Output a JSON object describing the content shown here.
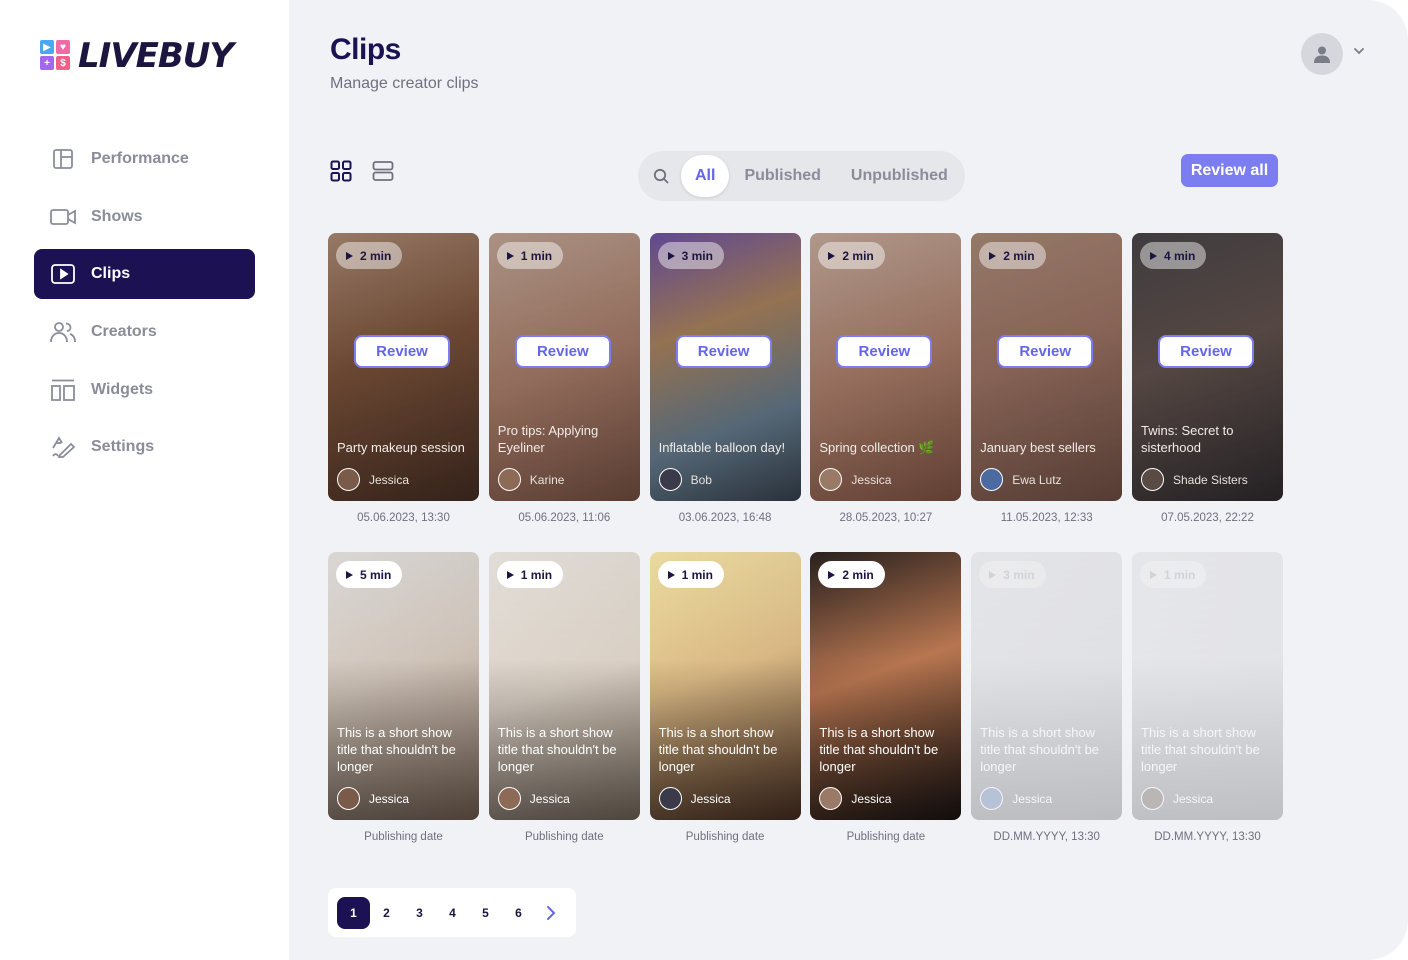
{
  "app": {
    "name": "LIVEBUY"
  },
  "sidebar": {
    "items": [
      {
        "label": "Performance",
        "icon": "layout-icon"
      },
      {
        "label": "Shows",
        "icon": "video-camera-icon"
      },
      {
        "label": "Clips",
        "icon": "play-square-icon",
        "active": true
      },
      {
        "label": "Creators",
        "icon": "users-icon"
      },
      {
        "label": "Widgets",
        "icon": "widgets-icon"
      },
      {
        "label": "Settings",
        "icon": "pen-settings-icon"
      }
    ]
  },
  "header": {
    "title": "Clips",
    "subtitle": "Manage creator clips"
  },
  "filters": {
    "tabs": [
      "All",
      "Published",
      "Unpublished"
    ],
    "active": "All"
  },
  "toolbar": {
    "review_all": "Review all"
  },
  "review_label": "Review",
  "clips": [
    {
      "duration": "2 min",
      "title": "Party makeup session",
      "author": "Jessica",
      "date": "05.06.2023, 13:30",
      "state": "pending"
    },
    {
      "duration": "1 min",
      "title": "Pro tips: Applying Eyeliner",
      "author": "Karine",
      "date": "05.06.2023, 11:06",
      "state": "pending"
    },
    {
      "duration": "3 min",
      "title": "Inflatable balloon day!",
      "author": "Bob",
      "date": "03.06.2023, 16:48",
      "state": "pending"
    },
    {
      "duration": "2 min",
      "title": "Spring collection 🌿",
      "author": "Jessica",
      "date": "28.05.2023, 10:27",
      "state": "pending"
    },
    {
      "duration": "2 min",
      "title": "January best sellers",
      "author": "Ewa Lutz",
      "date": "11.05.2023, 12:33",
      "state": "pending"
    },
    {
      "duration": "4 min",
      "title": "Twins: Secret to sisterhood",
      "author": "Shade Sisters",
      "date": "07.05.2023, 22:22",
      "state": "pending"
    },
    {
      "duration": "5 min",
      "title": "This is a short show title that shouldn't be longer",
      "author": "Jessica",
      "date": "Publishing date",
      "state": "published"
    },
    {
      "duration": "1 min",
      "title": "This is a short show title that shouldn't be longer",
      "author": "Jessica",
      "date": "Publishing date",
      "state": "published"
    },
    {
      "duration": "1 min",
      "title": "This is a short show title that shouldn't be longer",
      "author": "Jessica",
      "date": "Publishing date",
      "state": "published"
    },
    {
      "duration": "2 min",
      "title": "This is a short show title that shouldn't be longer",
      "author": "Jessica",
      "date": "Publishing date",
      "state": "published"
    },
    {
      "duration": "3 min",
      "title": "This is a short show title that shouldn't be longer",
      "author": "Jessica",
      "date": "DD.MM.YYYY, 13:30",
      "state": "faded"
    },
    {
      "duration": "1 min",
      "title": "This is a short show title that shouldn't be longer",
      "author": "Jessica",
      "date": "DD.MM.YYYY, 13:30",
      "state": "faded"
    }
  ],
  "pagination": {
    "pages": [
      "1",
      "2",
      "3",
      "4",
      "5",
      "6"
    ],
    "current": "1"
  },
  "colors": {
    "brand_dark": "#1c1153",
    "accent": "#7b7df0",
    "main_bg": "#f1f2f5"
  }
}
